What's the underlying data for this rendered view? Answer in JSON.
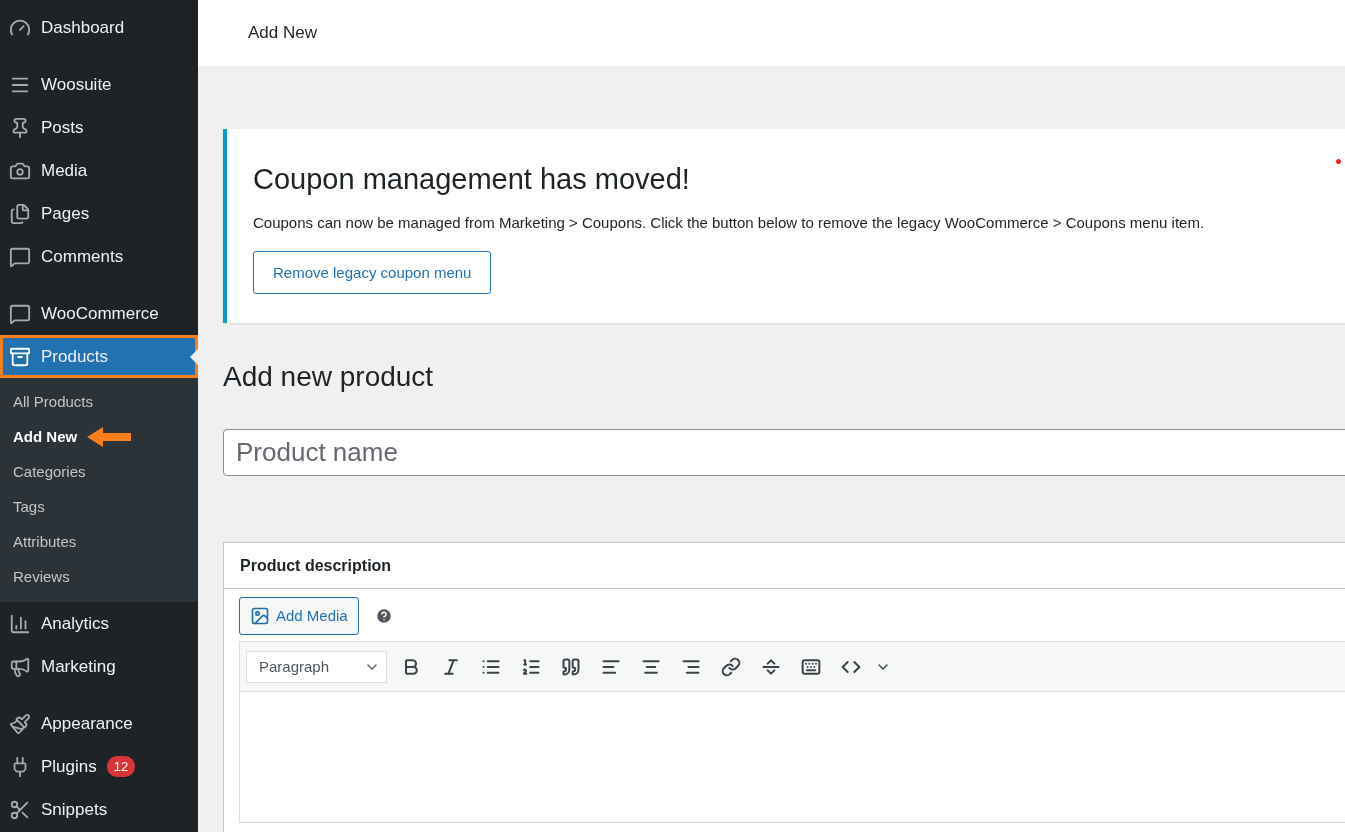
{
  "sidebar": {
    "groups": [
      [
        {
          "label": "Dashboard",
          "selected": false
        }
      ],
      [
        {
          "label": "Woosuite",
          "selected": false
        },
        {
          "label": "Posts",
          "selected": false
        },
        {
          "label": "Media",
          "selected": false
        },
        {
          "label": "Pages",
          "selected": false
        },
        {
          "label": "Comments",
          "selected": false
        }
      ],
      [
        {
          "label": "WooCommerce",
          "selected": false
        },
        {
          "label": "Products",
          "selected": true,
          "children": [
            {
              "label": "All Products",
              "selected": false
            },
            {
              "label": "Add New",
              "selected": true
            },
            {
              "label": "Categories",
              "selected": false
            },
            {
              "label": "Tags",
              "selected": false
            },
            {
              "label": "Attributes",
              "selected": false
            },
            {
              "label": "Reviews",
              "selected": false
            }
          ]
        },
        {
          "label": "Analytics",
          "selected": false
        },
        {
          "label": "Marketing",
          "selected": false
        }
      ],
      [
        {
          "label": "Appearance",
          "selected": false
        },
        {
          "label": "Plugins",
          "selected": false,
          "badge": "12"
        },
        {
          "label": "Snippets",
          "selected": false
        }
      ]
    ]
  },
  "top_bar": {
    "title": "Add New"
  },
  "notice": {
    "title": "Coupon management has moved!",
    "text": "Coupons can now be managed from Marketing > Coupons. Click the button below to remove the legacy WooCommerce > Coupons menu item.",
    "button": "Remove legacy coupon menu"
  },
  "page_title": "Add new product",
  "product_name": {
    "placeholder": "Product name"
  },
  "description": {
    "title": "Product description",
    "add_media": "Add Media",
    "format": "Paragraph"
  }
}
